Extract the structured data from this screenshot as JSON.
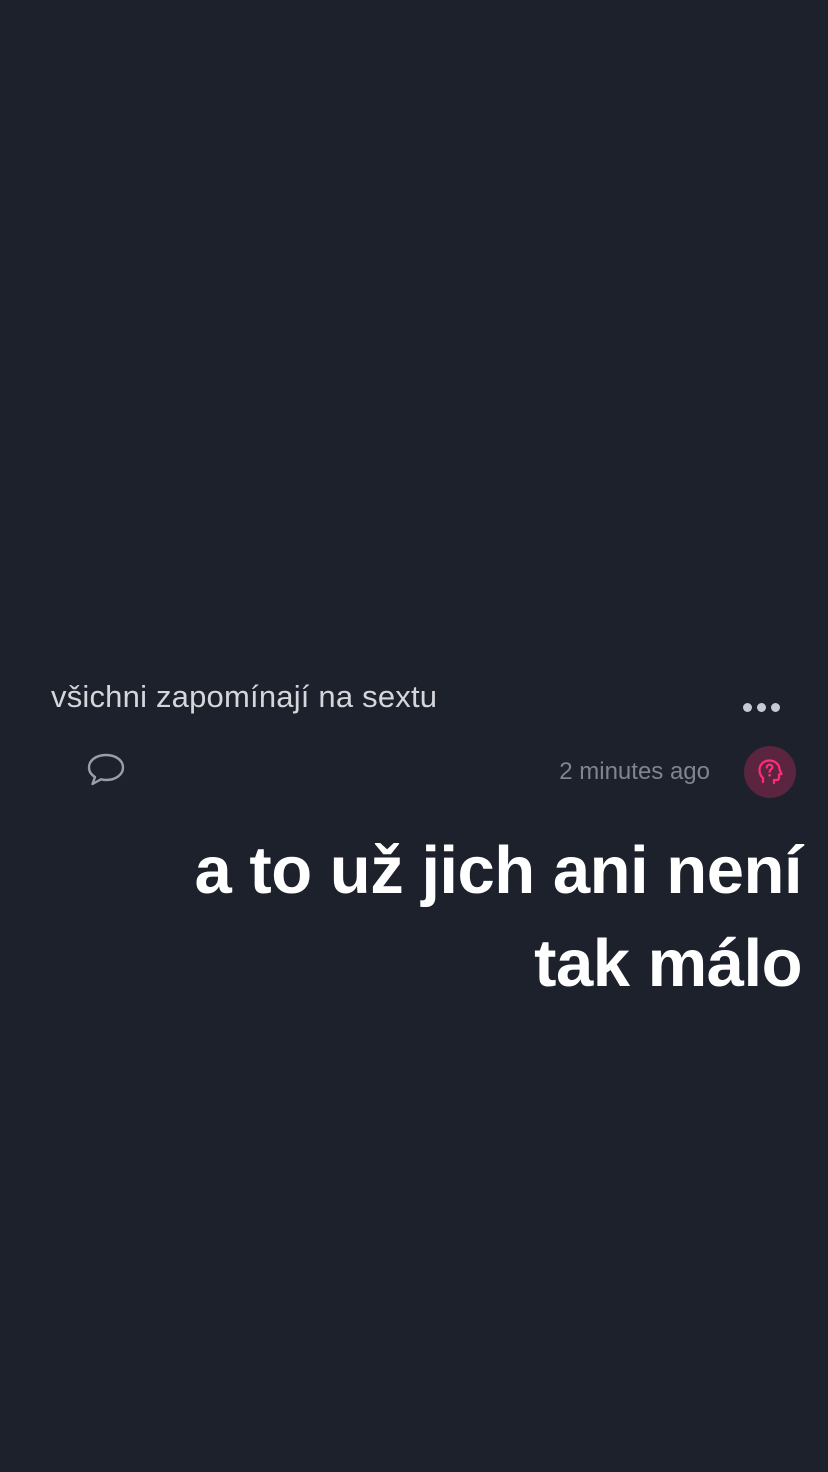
{
  "post": {
    "text": "všichni zapomínají na sextu",
    "timestamp": "2 minutes ago"
  },
  "icons": {
    "more": "more-dots-icon",
    "comment": "speech-bubble-icon",
    "avatar": "question-head-icon",
    "avatar_color": "#ff2d78"
  },
  "caption": {
    "line1": "a to už jich ani není",
    "line2": "tak málo"
  },
  "colors": {
    "background": "#1c212c",
    "text": "#d4d6da",
    "muted": "#80848d"
  }
}
